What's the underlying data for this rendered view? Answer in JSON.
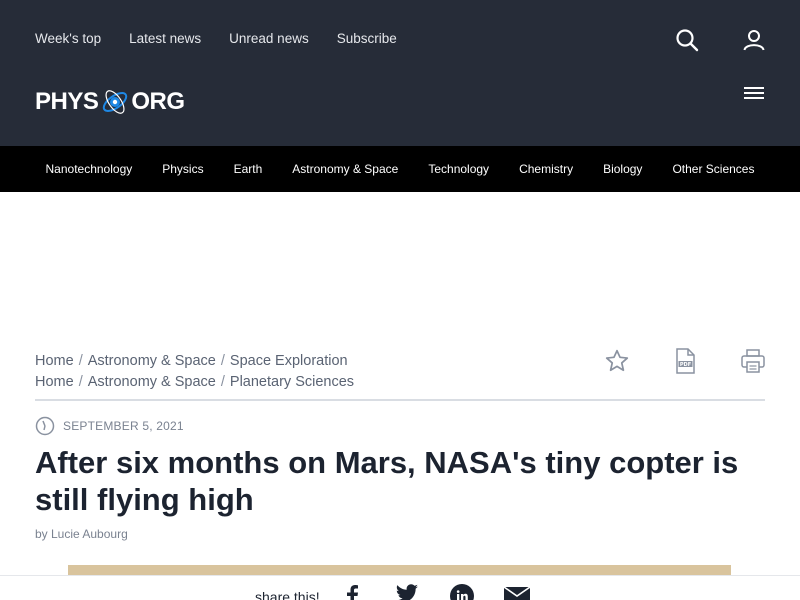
{
  "topnav": {
    "items": [
      "Week's top",
      "Latest news",
      "Unread news",
      "Subscribe"
    ]
  },
  "logo": {
    "left": "PHYS",
    "right": "ORG"
  },
  "categories": [
    "Nanotechnology",
    "Physics",
    "Earth",
    "Astronomy & Space",
    "Technology",
    "Chemistry",
    "Biology",
    "Other Sciences"
  ],
  "breadcrumbs": [
    [
      "Home",
      "Astronomy & Space",
      "Space Exploration"
    ],
    [
      "Home",
      "Astronomy & Space",
      "Planetary Sciences"
    ]
  ],
  "breadcrumb_separator": "/",
  "article": {
    "date": "SEPTEMBER 5, 2021",
    "title": "After six months on Mars, NASA's tiny copter is still flying high",
    "byline": "by Lucie Aubourg"
  },
  "share": {
    "label": "share this!"
  },
  "colors": {
    "header_bg": "#262c38",
    "category_bar_bg": "#000000",
    "logo_accent": "#1e88e5",
    "hero_tone": "#d9c49d"
  },
  "icons": [
    "search-icon",
    "user-icon",
    "menu-icon",
    "bookmark-star-icon",
    "pdf-icon",
    "print-icon",
    "clock-icon",
    "facebook-icon",
    "twitter-icon",
    "linkedin-icon",
    "email-icon"
  ]
}
